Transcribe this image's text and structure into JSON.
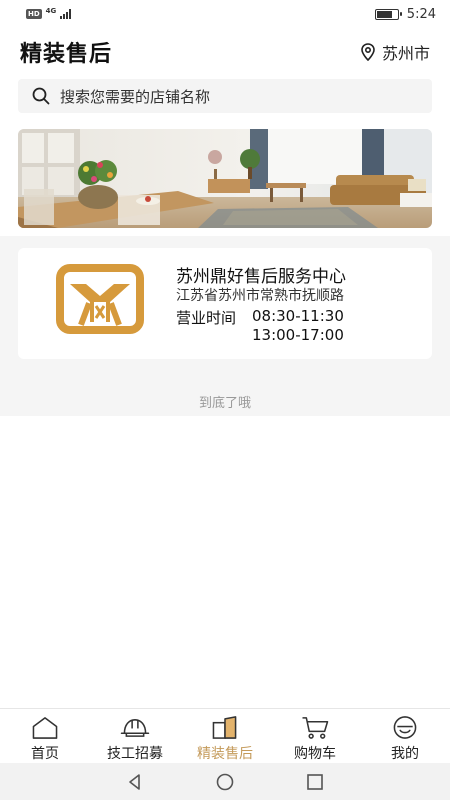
{
  "status_bar": {
    "hd": "HD",
    "network": "4G",
    "time": "5:24",
    "battery_level": 0.7
  },
  "header": {
    "title": "精装售后",
    "location": "苏州市",
    "location_icon": "map-pin-icon"
  },
  "search": {
    "placeholder": "搜索您需要的店铺名称",
    "icon": "search-icon"
  },
  "store": {
    "name": "苏州鼎好售后服务中心",
    "address": "江苏省苏州市常熟市抚顺路",
    "hours_label": "营业时间",
    "hours": [
      "08:30-11:30",
      "13:00-17:00"
    ]
  },
  "end_text": "到底了哦",
  "tabs": [
    {
      "label": "首页",
      "icon": "home-icon",
      "active": false
    },
    {
      "label": "技工招募",
      "icon": "hard-hat-icon",
      "active": false
    },
    {
      "label": "精装售后",
      "icon": "door-icon",
      "active": true
    },
    {
      "label": "购物车",
      "icon": "cart-icon",
      "active": false
    },
    {
      "label": "我的",
      "icon": "smile-icon",
      "active": false
    }
  ],
  "colors": {
    "accent": "#c49a5a",
    "logo": "#d69a3c"
  }
}
